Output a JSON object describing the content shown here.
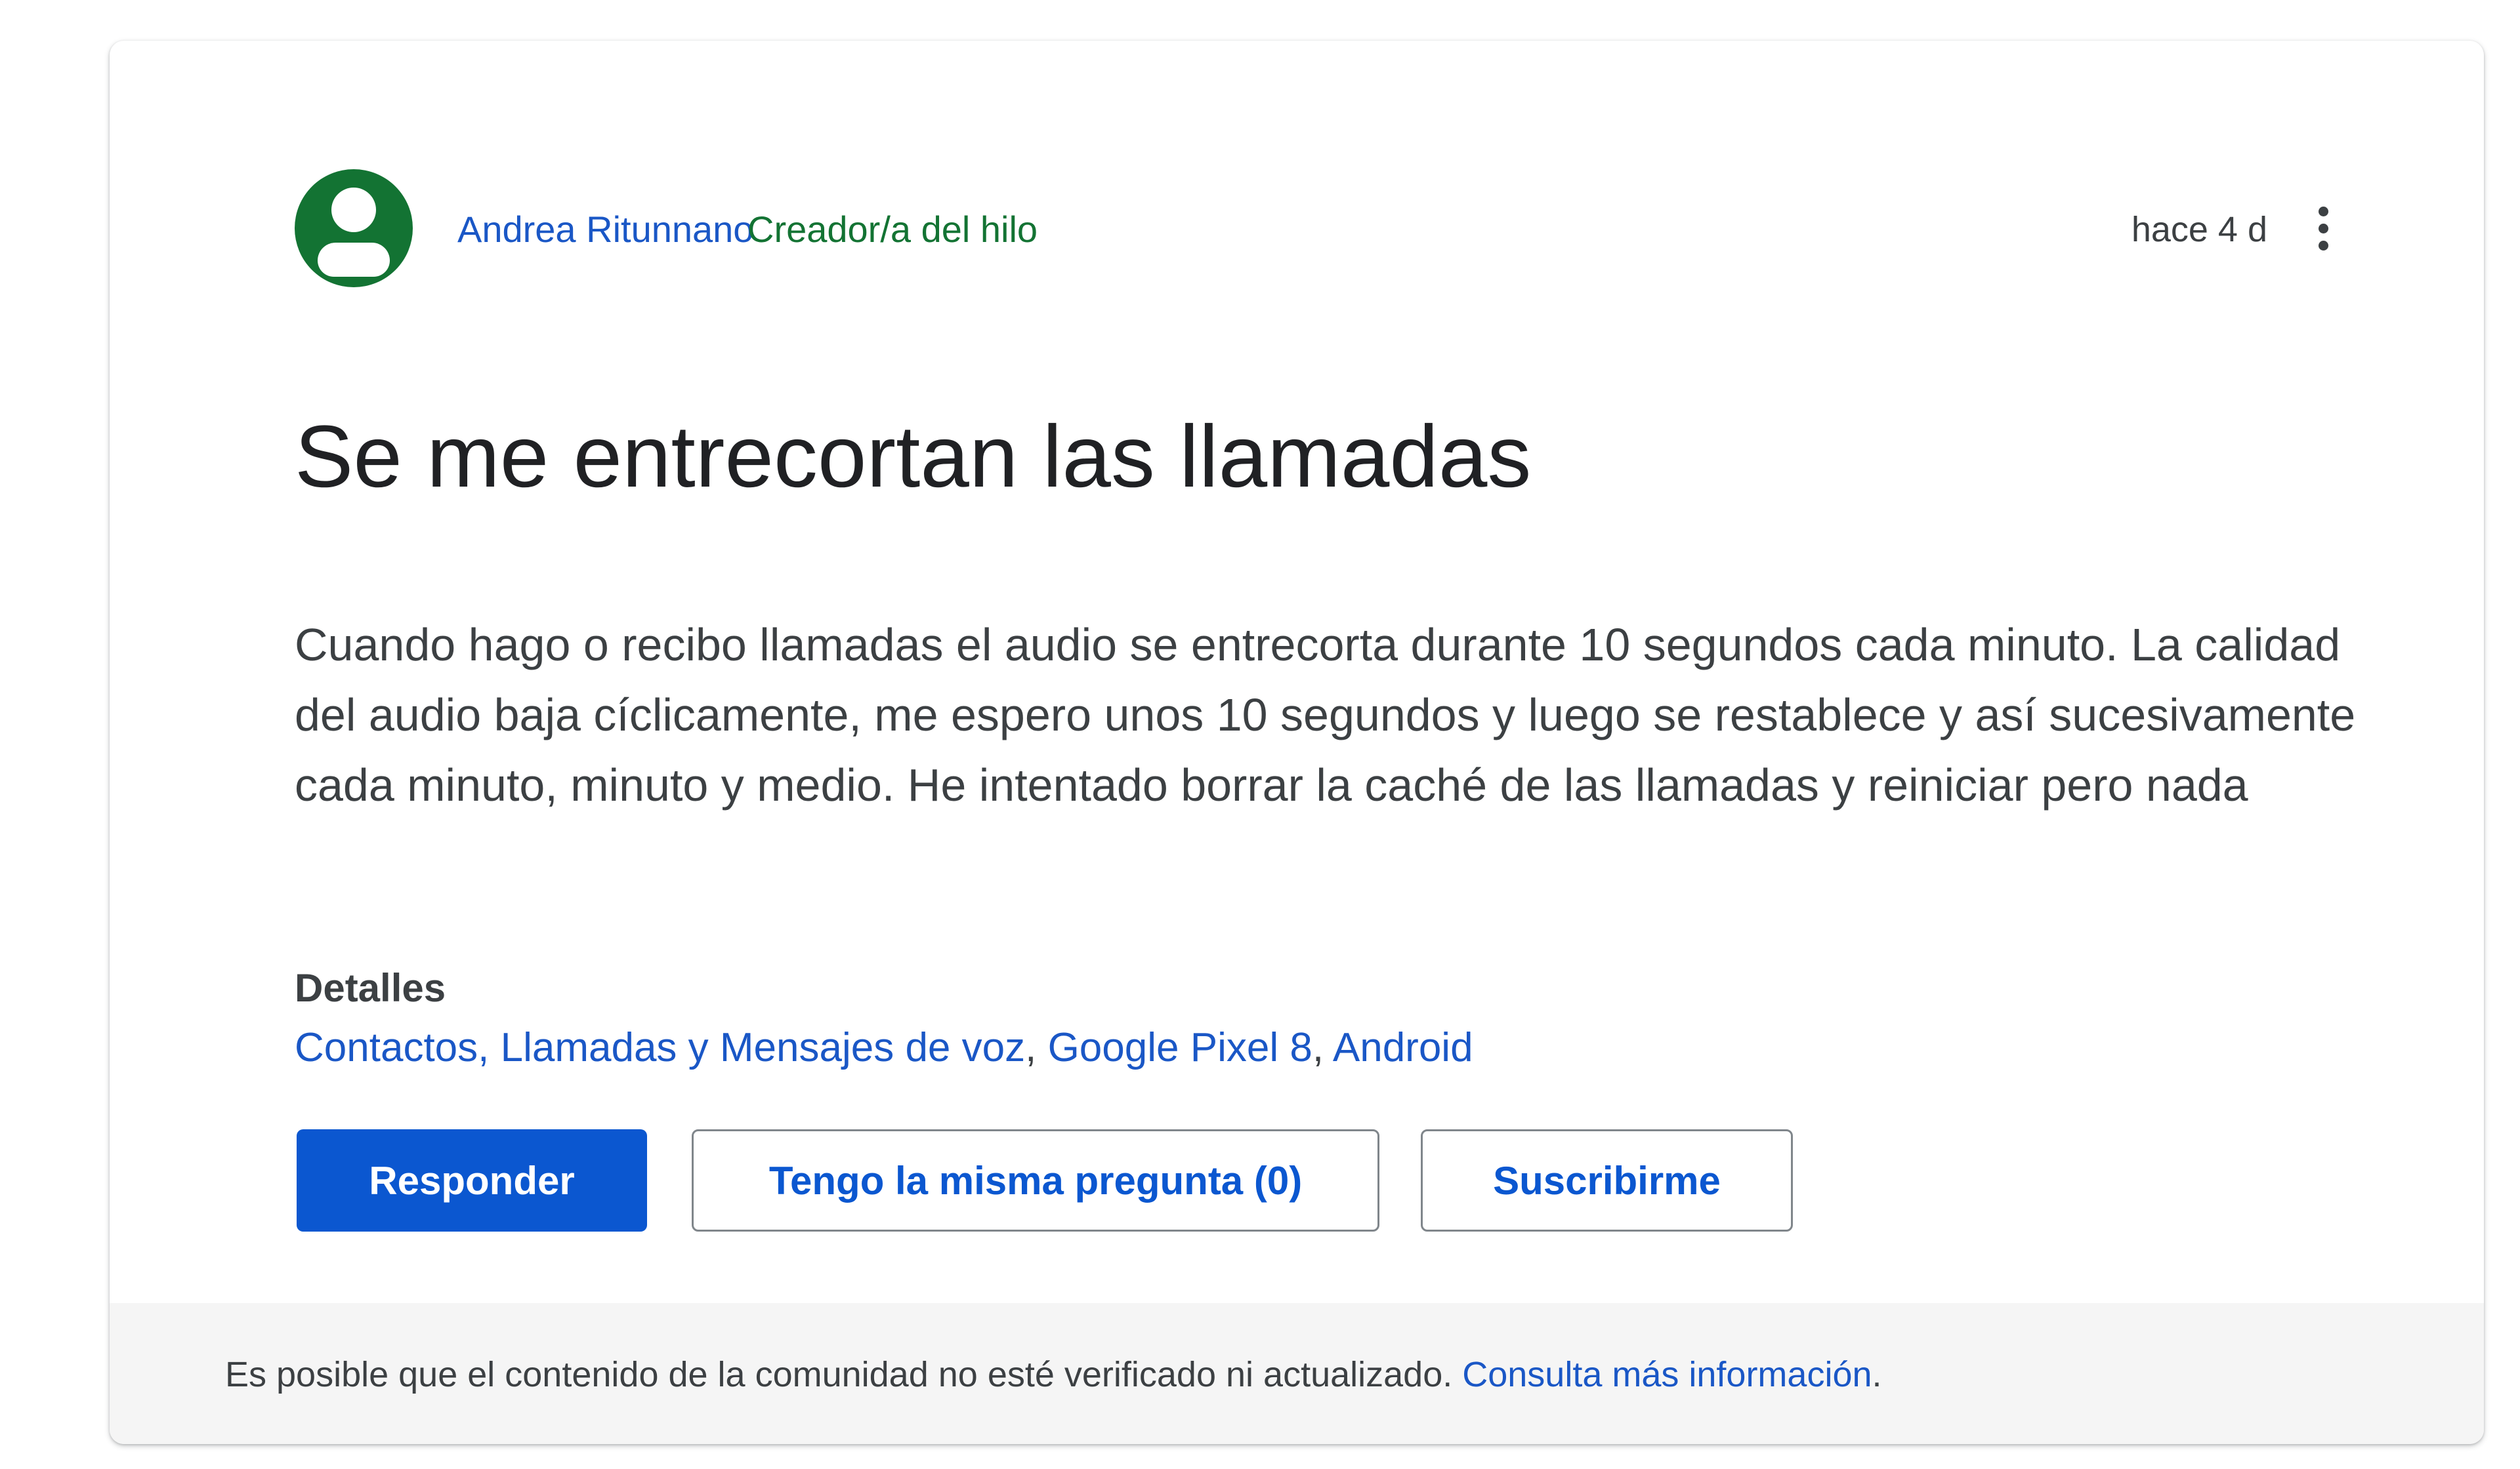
{
  "post": {
    "author": "Andrea Ritunnano",
    "badge": "Creador/a del hilo",
    "timestamp": "hace 4 d",
    "title": "Se me entrecortan las llamadas",
    "body": "Cuando hago o recibo llamadas el audio se entrecorta durante 10 segundos cada minuto. La calidad del audio baja cíclicamente, me espero unos 10 segundos y luego se restablece y así sucesivamente cada minuto, minuto y medio. He intentado borrar la caché de las llamadas y reiniciar pero nada",
    "details_label": "Detalles",
    "details": [
      "Contactos, Llamadas y Mensajes de voz",
      "Google Pixel 8",
      "Android"
    ],
    "details_separator": ", "
  },
  "actions": {
    "reply": "Responder",
    "same_question": "Tengo la misma pregunta (0)",
    "subscribe": "Suscribirme"
  },
  "footer": {
    "notice": "Es posible que el contenido de la comunidad no esté verificado ni actualizado. ",
    "link": "Consulta más información",
    "end": "."
  },
  "icons": {
    "avatar": "account-circle-icon",
    "more": "more-vert-icon"
  },
  "colors": {
    "author_link": "#1a57c6",
    "creator_badge": "#137333",
    "primary_button": "#0b57d0",
    "avatar_bg": "#137333",
    "footer_bg": "#f5f5f5"
  }
}
